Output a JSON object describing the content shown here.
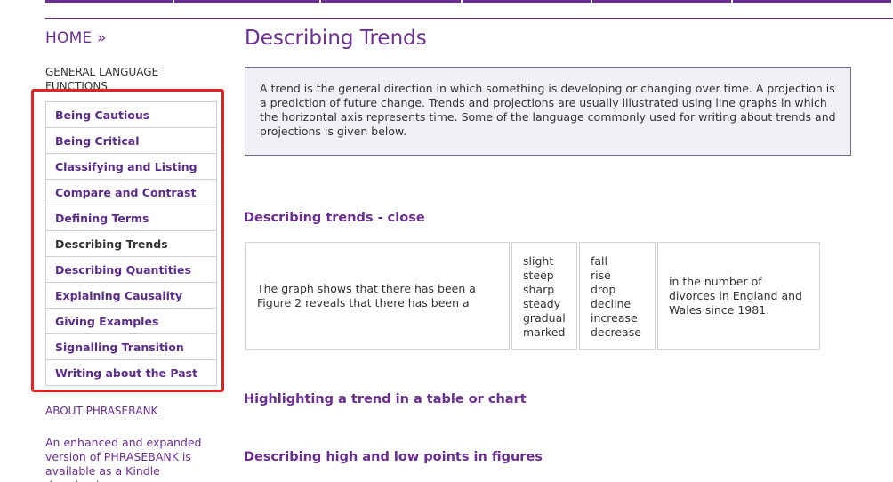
{
  "sidebar": {
    "home": "HOME »",
    "section_heading": "GENERAL LANGUAGE FUNCTIONS",
    "items": [
      {
        "label": "Being Cautious"
      },
      {
        "label": "Being Critical"
      },
      {
        "label": "Classifying and Listing"
      },
      {
        "label": "Compare and Contrast"
      },
      {
        "label": "Defining Terms"
      },
      {
        "label": "Describing Trends",
        "current": true
      },
      {
        "label": "Describing Quantities"
      },
      {
        "label": "Explaining Causality"
      },
      {
        "label": "Giving Examples"
      },
      {
        "label": "Signalling Transition"
      },
      {
        "label": "Writing about the Past"
      }
    ],
    "about": "ABOUT PHRASEBANK",
    "promo": "An enhanced and expanded version of PHRASEBANK is available as a Kindle download"
  },
  "main": {
    "title": "Describing Trends",
    "intro": "A trend is the general direction in which something is developing or changing over time. A projection is a prediction of future change. Trends and projections are usually illustrated using line graphs in which the horizontal axis represents time. Some of the language commonly used for writing about trends and projections is given below.",
    "section1": "Describing trends - close",
    "table": {
      "col1": [
        "The graph shows that there has been a",
        "Figure 2  reveals that there has been a"
      ],
      "col2": [
        "slight",
        "steep",
        "sharp",
        "steady",
        "gradual",
        "marked"
      ],
      "col3": [
        "fall",
        "rise",
        "drop",
        "decline",
        "increase",
        "decrease"
      ],
      "col4": "in the number of divorces in England and Wales since 1981."
    },
    "section2": "Highlighting a trend in a table or chart",
    "section3": "Describing high and low points in figures"
  },
  "colors": {
    "accent": "#6a2d91",
    "link": "#5b2c8a",
    "highlight_box": "#e52222",
    "intro_bg": "#f0f0f5"
  }
}
